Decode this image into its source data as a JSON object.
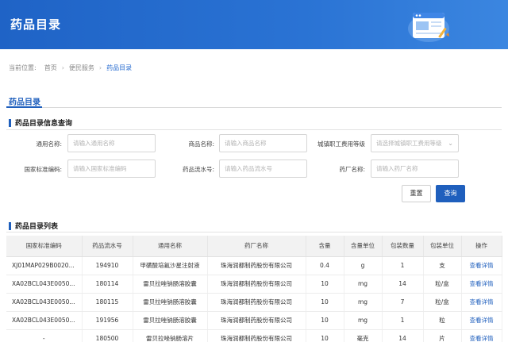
{
  "banner": {
    "title": "药品目录"
  },
  "breadcrumb": {
    "prefix": "当前位置:",
    "items": [
      "首页",
      "便民服务",
      "药品目录"
    ]
  },
  "tab": {
    "label": "药品目录"
  },
  "query_section": {
    "title": "药品目录信息查询"
  },
  "fields": {
    "generic_name": {
      "label": "通用名称:",
      "placeholder": "请输入通用名称"
    },
    "product_name": {
      "label": "商品名称:",
      "placeholder": "请输入商品名称"
    },
    "insurance_grade": {
      "label": "城镇职工费用等级",
      "placeholder": "请选择城镇职工费用等级"
    },
    "national_code": {
      "label": "国家标准编码:",
      "placeholder": "请输入国家标准编码"
    },
    "serial_no": {
      "label": "药品流水号:",
      "placeholder": "请输入药品流水号"
    },
    "manufacturer": {
      "label": "药厂名称:",
      "placeholder": "请输入药厂名称"
    }
  },
  "buttons": {
    "reset": "重置",
    "query": "查询"
  },
  "list_section": {
    "title": "药品目录列表"
  },
  "table": {
    "headers": [
      "国家标准编码",
      "药品流水号",
      "通用名称",
      "药厂名称",
      "含量",
      "含量单位",
      "包装数量",
      "包装单位",
      "操作"
    ],
    "rows": [
      [
        "XJ01MAP029B0020...",
        "194910",
        "甲磺酸培氟沙星注射液",
        "珠海润都制药股份有限公司",
        "0.4",
        "g",
        "1",
        "支",
        "查看详情"
      ],
      [
        "XA02BCL043E0050...",
        "180114",
        "雷贝拉唑钠肠溶胶囊",
        "珠海润都制药股份有限公司",
        "10",
        "mg",
        "14",
        "粒/盒",
        "查看详情"
      ],
      [
        "XA02BCL043E0050...",
        "180115",
        "雷贝拉唑钠肠溶胶囊",
        "珠海润都制药股份有限公司",
        "10",
        "mg",
        "7",
        "粒/盒",
        "查看详情"
      ],
      [
        "XA02BCL043E0050...",
        "191956",
        "雷贝拉唑钠肠溶胶囊",
        "珠海润都制药股份有限公司",
        "10",
        "mg",
        "1",
        "粒",
        "查看详情"
      ],
      [
        "-",
        "180500",
        "雷贝拉唑钠肠溶片",
        "珠海润都制药股份有限公司",
        "10",
        "毫克",
        "14",
        "片",
        "查看详情"
      ]
    ]
  }
}
